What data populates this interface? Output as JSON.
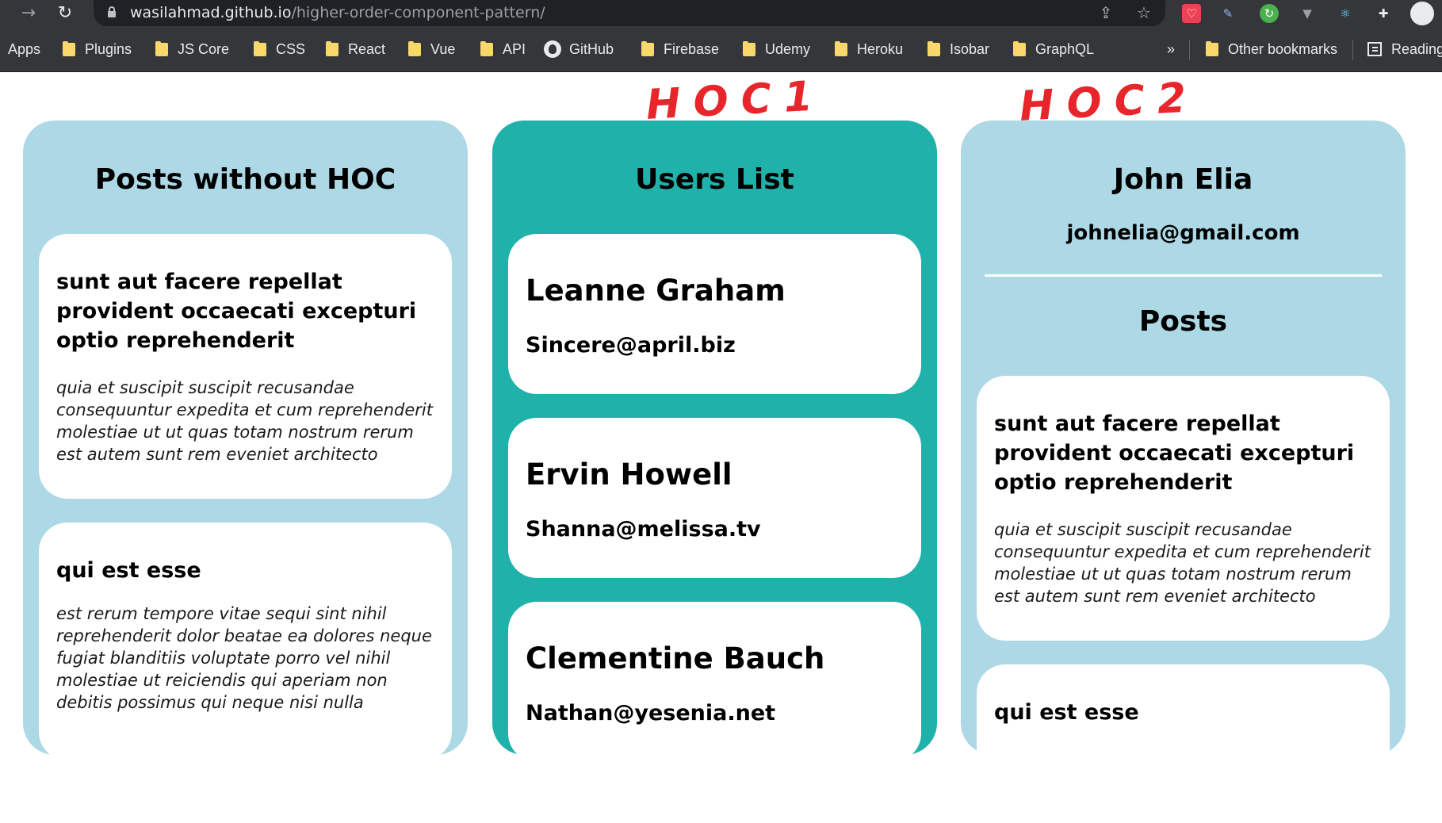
{
  "browser": {
    "url_host": "wasilahmad.github.io",
    "url_path": "/higher-order-component-pattern/",
    "bookmarks": [
      "Apps",
      "Plugins",
      "JS Core",
      "CSS",
      "React",
      "Vue",
      "API",
      "GitHub",
      "Firebase",
      "Udemy",
      "Heroku",
      "Isobar",
      "GraphQL"
    ],
    "overflow": "»",
    "other_bookmarks": "Other bookmarks",
    "reading_list": "Reading"
  },
  "annotations": {
    "hoc1": "HOC1",
    "hoc2": "HOC2"
  },
  "posts_without_hoc": {
    "title": "Posts without HOC",
    "posts": [
      {
        "title": "sunt aut facere repellat provident occaecati excepturi optio reprehenderit",
        "body": "quia et suscipit suscipit recusandae consequuntur expedita et cum reprehenderit molestiae ut ut quas totam nostrum rerum est autem sunt rem eveniet architecto"
      },
      {
        "title": "qui est esse",
        "body": "est rerum tempore vitae sequi sint nihil reprehenderit dolor beatae ea dolores neque fugiat blanditiis voluptate porro vel nihil molestiae ut reiciendis qui aperiam non debitis possimus qui neque nisi nulla"
      }
    ]
  },
  "users_list": {
    "title": "Users List",
    "users": [
      {
        "name": "Leanne Graham",
        "email": "Sincere@april.biz"
      },
      {
        "name": "Ervin Howell",
        "email": "Shanna@melissa.tv"
      },
      {
        "name": "Clementine Bauch",
        "email": "Nathan@yesenia.net"
      }
    ]
  },
  "profile": {
    "name": "John Elia",
    "email": "johnelia@gmail.com",
    "posts_title": "Posts",
    "posts": [
      {
        "title": "sunt aut facere repellat provident occaecati excepturi optio reprehenderit",
        "body": "quia et suscipit suscipit recusandae consequuntur expedita et cum reprehenderit molestiae ut ut quas totam nostrum rerum est autem sunt rem eveniet architecto"
      },
      {
        "title": "qui est esse"
      }
    ]
  },
  "colors": {
    "light_panel": "#add8e6",
    "teal_panel": "#20b2aa",
    "annotation": "#e8252a"
  }
}
